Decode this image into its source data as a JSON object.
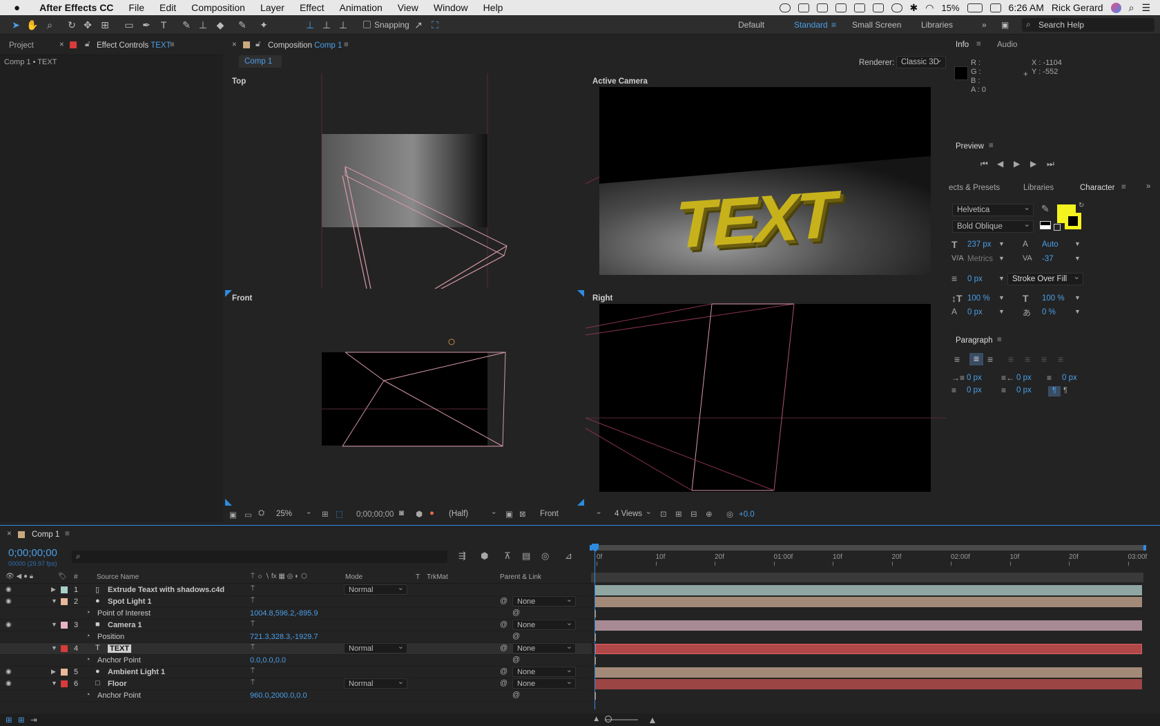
{
  "menubar": {
    "apple_icon": "apple-icon",
    "app": "After Effects CC",
    "items": [
      "File",
      "Edit",
      "Composition",
      "Layer",
      "Effect",
      "Animation",
      "View",
      "Window",
      "Help"
    ],
    "battery": "15%",
    "time": "6:26 AM",
    "user": "Rick Gerard"
  },
  "toolbar": {
    "snapping": "Snapping",
    "workspaces": [
      "Default",
      "Standard",
      "Small Screen",
      "Libraries"
    ],
    "active_workspace": "Standard",
    "search_placeholder": "Search Help"
  },
  "left_panel": {
    "tab_project": "Project",
    "tab_effect_controls": "Effect Controls",
    "effect_target": "TEXT",
    "breadcrumb": "Comp 1 • TEXT"
  },
  "comp_panel": {
    "tab_label": "Composition",
    "tab_comp": "Comp 1",
    "sub_tab": "Comp 1",
    "renderer_label": "Renderer:",
    "renderer_value": "Classic 3D",
    "views": {
      "top": "Top",
      "active": "Active Camera",
      "front": "Front",
      "right": "Right"
    },
    "scene_text": "TEXT",
    "footer": {
      "zoom": "25%",
      "timecode": "0;00;00;00",
      "resolution": "(Half)",
      "view": "Front",
      "layout": "4 Views",
      "exposure": "+0.0"
    }
  },
  "info": {
    "title": "Info",
    "audio": "Audio",
    "r": "R :",
    "g": "G :",
    "b": "B :",
    "a": "A : 0",
    "x": "X : -1104",
    "y": "Y : -552"
  },
  "preview": {
    "title": "Preview"
  },
  "char_tabs": {
    "effects": "ects & Presets",
    "libraries": "Libraries",
    "character": "Character"
  },
  "character": {
    "font": "Helvetica",
    "style": "Bold Oblique",
    "size": "237 px",
    "leading": "Auto",
    "kerning": "Metrics",
    "tracking": "-37",
    "stroke_width": "0 px",
    "stroke_type": "Stroke Over Fill",
    "vscale": "100 %",
    "hscale": "100 %",
    "baseline": "0 px",
    "tsume": "0 %",
    "fill_color": "#f4f21f"
  },
  "paragraph": {
    "title": "Paragraph",
    "indent_left": "0 px",
    "indent_right": "0 px",
    "indent_first": "0 px",
    "space_before": "0 px",
    "space_after": "0 px"
  },
  "timeline": {
    "tab": "Comp 1",
    "timecode": "0;00;00;00",
    "frames": "00000 (29.97 fps)",
    "cols": {
      "num": "#",
      "source": "Source Name",
      "mode": "Mode",
      "t": "T",
      "trkmat": "TrkMat",
      "parent": "Parent & Link"
    },
    "ruler": [
      "0f",
      "10f",
      "20f",
      "01:00f",
      "10f",
      "20f",
      "02:00f",
      "10f",
      "20f",
      "03:00f"
    ],
    "layers": [
      {
        "num": "1",
        "name": "Extrude Teaxt with shadows.c4d",
        "color": "#a8d0c8",
        "mode": "Normal",
        "parent": "",
        "prop": "",
        "value": "",
        "bar": "#8fa6a3"
      },
      {
        "num": "2",
        "name": "Spot Light 1",
        "color": "#e8b89a",
        "mode": "",
        "parent": "None",
        "prop": "Point of Interest",
        "value": "1004.8,596.2,-895.9",
        "bar": "#a38a78"
      },
      {
        "num": "3",
        "name": "Camera 1",
        "color": "#e8b4c4",
        "mode": "",
        "parent": "None",
        "prop": "Position",
        "value": "721.3,328.3,-1929.7",
        "bar": "#a88a95"
      },
      {
        "num": "4",
        "name": "TEXT",
        "color": "#d93a3a",
        "mode": "Normal",
        "parent": "None",
        "prop": "Anchor Point",
        "value": "0.0,0.0,0.0",
        "bar": "#b04848"
      },
      {
        "num": "5",
        "name": "Ambient Light 1",
        "color": "#e8b89a",
        "mode": "",
        "parent": "None",
        "prop": "",
        "value": "",
        "bar": "#a38a78"
      },
      {
        "num": "6",
        "name": "Floor",
        "color": "#d93a3a",
        "mode": "Normal",
        "parent": "None",
        "prop": "Anchor Point",
        "value": "960.0,2000.0,0.0",
        "bar": "#9c4545"
      }
    ]
  }
}
